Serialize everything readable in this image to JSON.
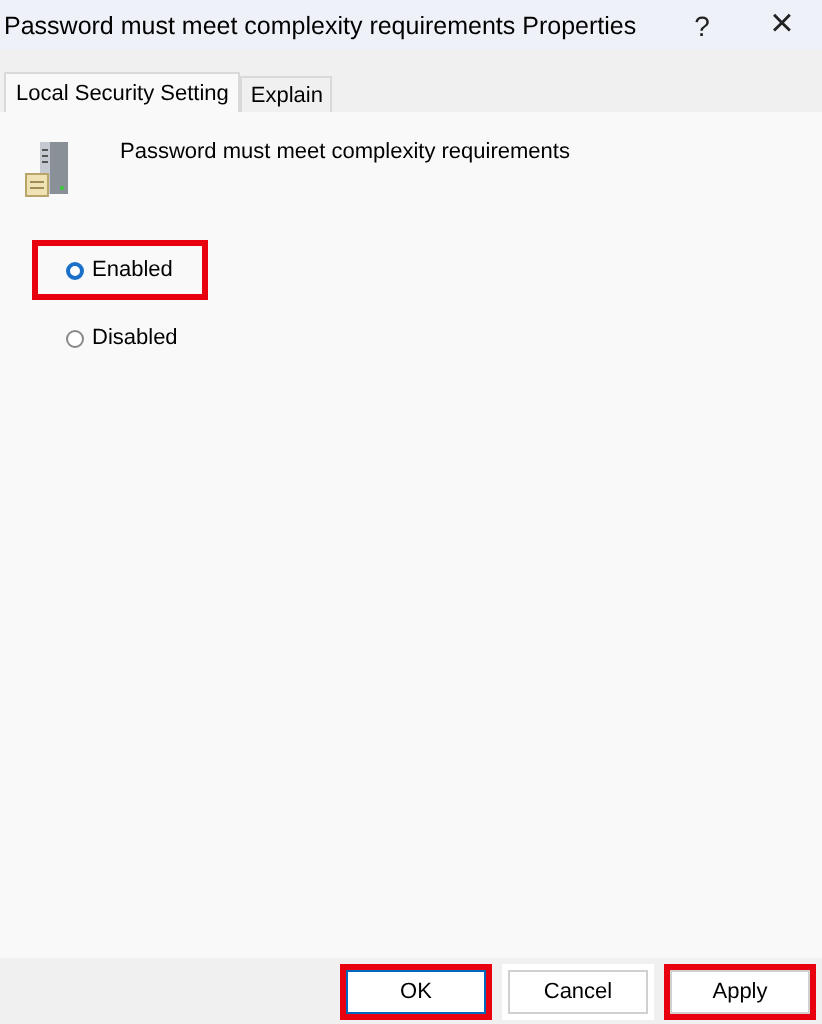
{
  "window": {
    "title": "Password must meet complexity requirements Properties",
    "help": "?",
    "close": "×"
  },
  "tabs": [
    {
      "label": "Local Security Setting",
      "selected": true
    },
    {
      "label": "Explain",
      "selected": false
    }
  ],
  "policy": {
    "name": "Password must meet complexity requirements"
  },
  "options": [
    {
      "label": "Enabled",
      "selected": true,
      "highlighted": true
    },
    {
      "label": "Disabled",
      "selected": false,
      "highlighted": false
    }
  ],
  "buttons": [
    {
      "label": "OK",
      "highlighted": true,
      "default": true
    },
    {
      "label": "Cancel",
      "highlighted": false,
      "default": false
    },
    {
      "label": "Apply",
      "highlighted": true,
      "default": false
    }
  ]
}
